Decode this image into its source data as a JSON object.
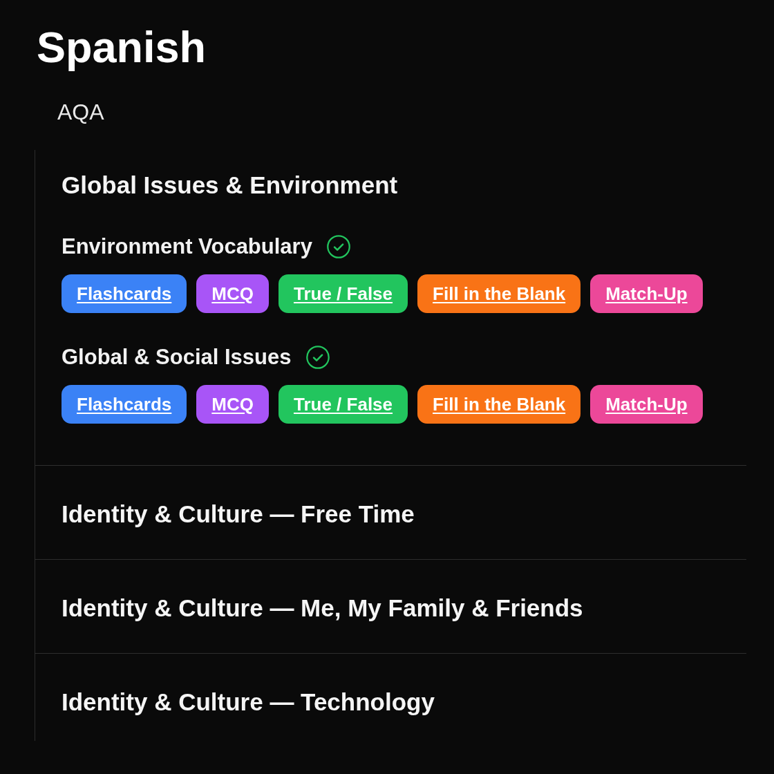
{
  "page": {
    "title": "Spanish",
    "exam_board": "AQA"
  },
  "sections": [
    {
      "title": "Global Issues & Environment",
      "topics": [
        {
          "name": "Environment Vocabulary",
          "completed": true,
          "activities": [
            {
              "label": "Flashcards",
              "color": "#3b82f6"
            },
            {
              "label": "MCQ",
              "color": "#a855f7"
            },
            {
              "label": "True / False",
              "color": "#22c55e"
            },
            {
              "label": "Fill in the Blank",
              "color": "#f97316"
            },
            {
              "label": "Match-Up",
              "color": "#ec4899"
            }
          ]
        },
        {
          "name": "Global & Social Issues",
          "completed": true,
          "activities": [
            {
              "label": "Flashcards",
              "color": "#3b82f6"
            },
            {
              "label": "MCQ",
              "color": "#a855f7"
            },
            {
              "label": "True / False",
              "color": "#22c55e"
            },
            {
              "label": "Fill in the Blank",
              "color": "#f97316"
            },
            {
              "label": "Match-Up",
              "color": "#ec4899"
            }
          ]
        }
      ]
    },
    {
      "title": "Identity & Culture — Free Time"
    },
    {
      "title": "Identity & Culture — Me, My Family & Friends"
    },
    {
      "title": "Identity & Culture — Technology"
    }
  ]
}
